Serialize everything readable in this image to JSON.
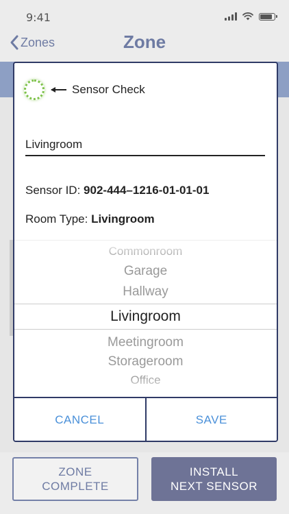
{
  "status_bar": {
    "time": "9:41"
  },
  "nav": {
    "back_label": "Zones",
    "title": "Zone"
  },
  "dialog": {
    "sensor_check_label": "Sensor Check",
    "zone_name_value": "Livingroom",
    "sensor_id_label": "Sensor ID:",
    "sensor_id_value": "902-444–1216-01-01-01",
    "room_type_label": "Room Type:",
    "room_type_value": "Livingroom",
    "picker": {
      "items": [
        "Commonroom",
        "Garage",
        "Hallway",
        "Livingroom",
        "Meetingroom",
        "Storageroom",
        "Office"
      ],
      "selected": "Livingroom"
    },
    "cancel_label": "CANCEL",
    "save_label": "SAVE"
  },
  "footer": {
    "zone_complete_line1": "ZONE",
    "zone_complete_line2": "COMPLETE",
    "install_next_line1": "INSTALL",
    "install_next_line2": "NEXT SENSOR"
  },
  "colors": {
    "accent": "#6e7ba3",
    "dialog_border": "#2f3a66",
    "link_blue": "#4a90d9",
    "sensor_green": "#7ec24a",
    "primary_button": "#6e7396"
  },
  "icons": {
    "back": "chevron-left-icon",
    "signal": "signal-icon",
    "wifi": "wifi-icon",
    "battery": "battery-icon",
    "sensor_status": "sensor-status-icon",
    "arrow": "arrow-left-icon"
  }
}
